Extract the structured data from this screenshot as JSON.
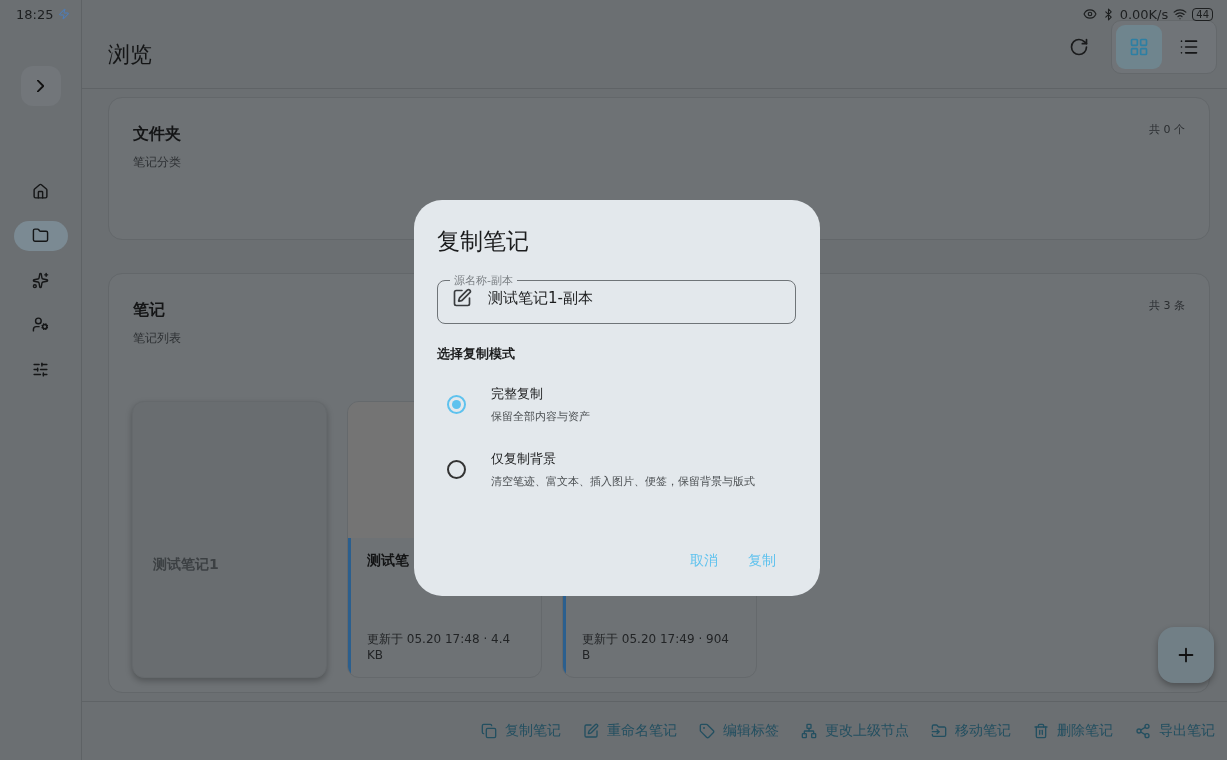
{
  "status_bar": {
    "time": "18:25",
    "net_speed": "0.00K/s",
    "battery": "44"
  },
  "sidebar": {
    "items": [
      {
        "kind": "home",
        "selected": false
      },
      {
        "kind": "folder",
        "selected": true
      },
      {
        "kind": "sparkles",
        "selected": false
      },
      {
        "kind": "user-settings",
        "selected": false
      },
      {
        "kind": "sliders",
        "selected": false
      }
    ]
  },
  "header": {
    "title": "浏览",
    "view_modes": [
      {
        "kind": "grid",
        "selected": true
      },
      {
        "kind": "list",
        "selected": false
      }
    ]
  },
  "folders": {
    "title": "文件夹",
    "subtitle": "笔记分类",
    "count": "共 0 个"
  },
  "notes": {
    "title": "笔记",
    "subtitle": "笔记列表",
    "count": "共 3 条",
    "cards": [
      {
        "title": "测试笔记1",
        "faded": true,
        "thumbnail": false
      },
      {
        "title": "测试笔",
        "meta": "更新于 05.20 17:48 · 4.4 KB",
        "faded": false,
        "thumbnail": true
      },
      {
        "meta": "更新于 05.20 17:49 · 904 B",
        "faded": false
      }
    ]
  },
  "toolbar": [
    {
      "kind": "copy",
      "label": "复制笔记"
    },
    {
      "kind": "rename",
      "label": "重命名笔记"
    },
    {
      "kind": "tag",
      "label": "编辑标签"
    },
    {
      "kind": "parent",
      "label": "更改上级节点"
    },
    {
      "kind": "move",
      "label": "移动笔记"
    },
    {
      "kind": "delete",
      "label": "删除笔记"
    },
    {
      "kind": "export",
      "label": "导出笔记"
    }
  ],
  "dialog": {
    "title": "复制笔记",
    "field": {
      "label": "源名称-副本",
      "value": "测试笔记1-副本"
    },
    "section": "选择复制模式",
    "options": [
      {
        "title": "完整复制",
        "description": "保留全部内容与资产",
        "selected": true
      },
      {
        "title": "仅复制背景",
        "description": "清空笔迹、富文本、插入图片、便签，保留背景与版式",
        "selected": false
      }
    ],
    "buttons": [
      "取消",
      "复制"
    ]
  }
}
